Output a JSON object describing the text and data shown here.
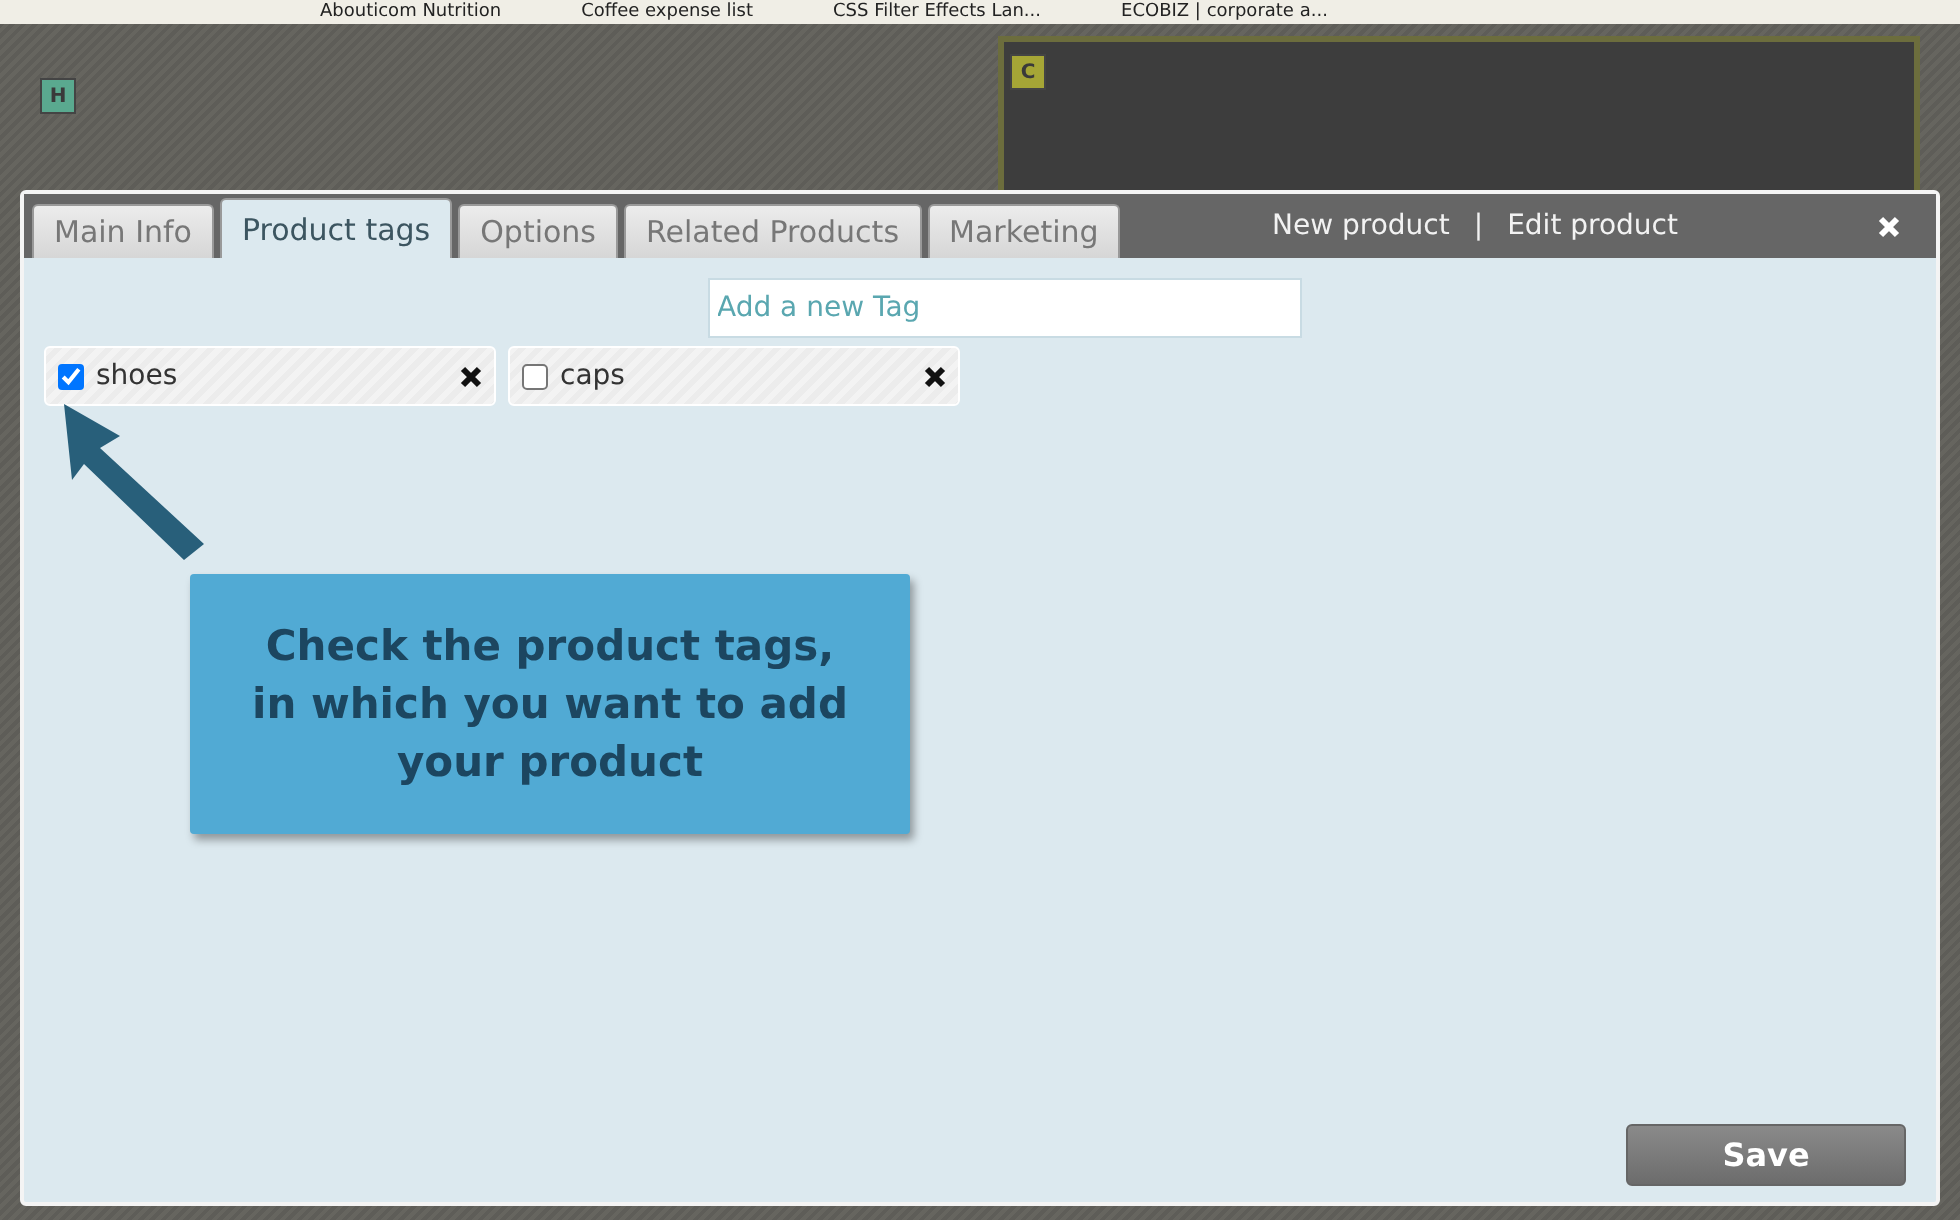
{
  "bookmarks": [
    "Abouticom Nutrition",
    "Coffee expense list",
    "CSS Filter Effects Lan...",
    "ECOBIZ | corporate a..."
  ],
  "background": {
    "badge_left": "H",
    "badge_right": "C"
  },
  "dialog": {
    "tabs": [
      {
        "label": "Main Info",
        "selected": false
      },
      {
        "label": "Product tags",
        "selected": true
      },
      {
        "label": "Options",
        "selected": false
      },
      {
        "label": "Related Products",
        "selected": false
      },
      {
        "label": "Marketing",
        "selected": false
      }
    ],
    "header_links": [
      "New product",
      "Edit product"
    ],
    "separator": "|",
    "new_tag": {
      "placeholder": "Add a new Tag"
    },
    "tags": [
      {
        "label": "shoes",
        "checked": true
      },
      {
        "label": "caps",
        "checked": false
      }
    ],
    "callout": "Check the product tags,\nin which you want to add\nyour product",
    "save_button": "Save"
  }
}
